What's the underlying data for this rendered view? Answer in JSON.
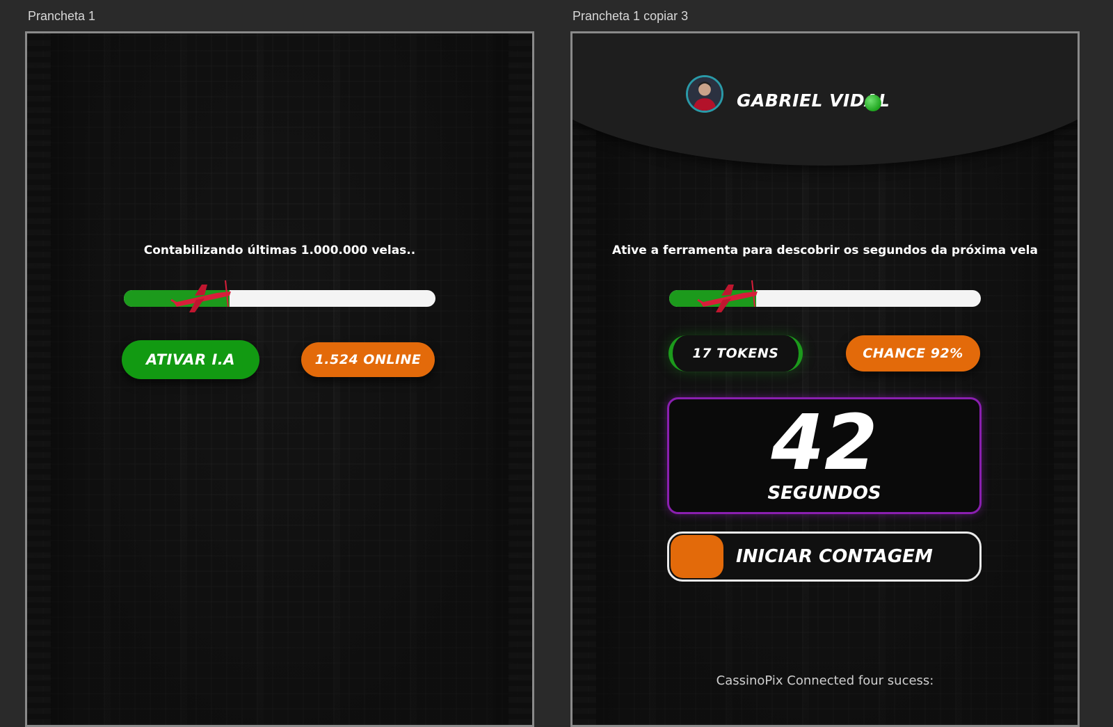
{
  "artboards": [
    {
      "label": "Prancheta 1",
      "heading": "Contabilizando últimas 1.000.000 velas..",
      "progress_fraction": 0.34,
      "activate_button": "ATIVAR I.A",
      "online_badge": "1.524 ONLINE"
    },
    {
      "label": "Prancheta 1 copiar 3",
      "user_name": "GABRIEL VIDAL",
      "heading": "Ative a ferramenta para descobrir os segundos da próxima vela",
      "progress_fraction": 0.28,
      "tokens_badge": "17 TOKENS",
      "chance_badge": "CHANCE 92%",
      "counter_value": "42",
      "counter_unit": "SEGUNDOS",
      "start_button": "INICIAR CONTAGEM",
      "footer": "CassinoPix Connected four sucess:"
    }
  ],
  "colors": {
    "green": "#129a12",
    "orange": "#e36a0a",
    "purple_border": "#8a1fb0",
    "online_dot": "#1fa51f"
  },
  "icons": {
    "plane": "airplane-icon",
    "status": "online-status-icon",
    "avatar": "user-avatar"
  }
}
